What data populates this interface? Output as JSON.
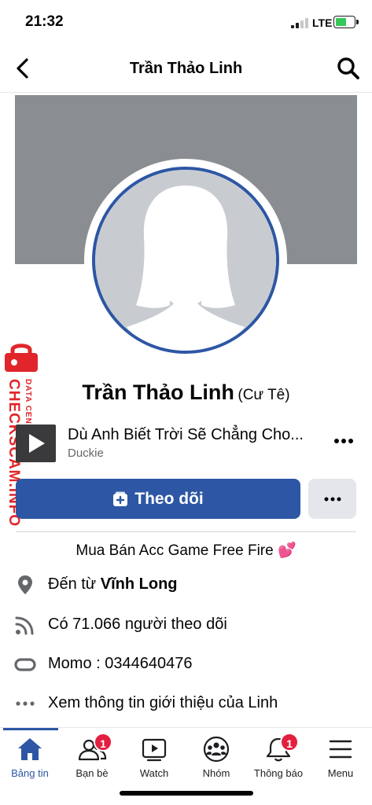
{
  "status_bar": {
    "time": "21:32",
    "network": "LTE"
  },
  "header": {
    "title": "Trần Thảo Linh",
    "back_icon": "chevron-left-icon",
    "search_icon": "search-icon"
  },
  "watermark": {
    "brand": "CHECKSCAM.INFO",
    "tagline": "DATA CENTER"
  },
  "profile": {
    "name": "Trần Thảo Linh",
    "alt_name": "(Cư Tê)"
  },
  "music": {
    "title": "Dù Anh Biết Trời Sẽ Chẳng Cho...",
    "artist": "Duckie"
  },
  "actions": {
    "follow_label": "Theo dõi",
    "more_label": "•••"
  },
  "bio": {
    "text": "Mua Bán Acc Game Free Fire 💕"
  },
  "info": {
    "hometown_prefix": "Đến từ ",
    "hometown": "Vĩnh Long",
    "followers": "Có 71.066 người theo dõi",
    "momo": "Momo : 0344640476",
    "about": "Xem thông tin giới thiệu của Linh"
  },
  "nav": {
    "items": [
      {
        "label": "Bảng tin",
        "icon": "home-icon",
        "active": true
      },
      {
        "label": "Bạn bè",
        "icon": "friends-icon",
        "badge": "1"
      },
      {
        "label": "Watch",
        "icon": "watch-icon"
      },
      {
        "label": "Nhóm",
        "icon": "groups-icon"
      },
      {
        "label": "Thông báo",
        "icon": "bell-icon",
        "badge": "1"
      },
      {
        "label": "Menu",
        "icon": "menu-icon"
      }
    ]
  },
  "colors": {
    "brand_blue": "#2d56a4",
    "badge_red": "#e41e3f",
    "cover_gray": "#8a8d91",
    "watermark_red": "#e0262a"
  }
}
